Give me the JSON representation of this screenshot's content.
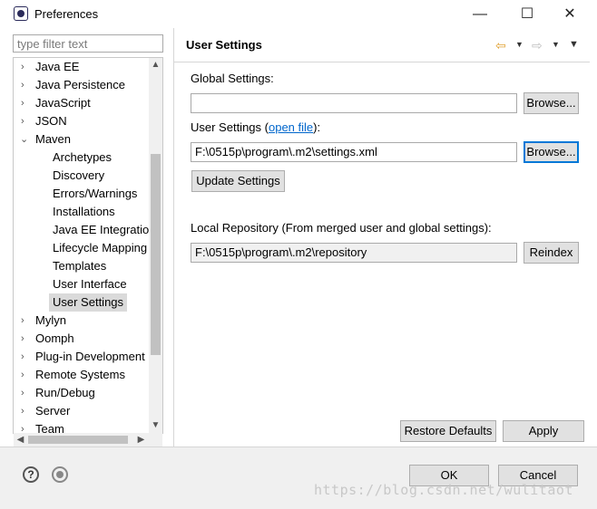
{
  "window": {
    "title": "Preferences",
    "minimize": "—",
    "maximize": "☐",
    "close": "✕"
  },
  "sidebar": {
    "filter_placeholder": "type filter text",
    "items": [
      {
        "label": "Java EE",
        "expander": "›"
      },
      {
        "label": "Java Persistence",
        "expander": "›"
      },
      {
        "label": "JavaScript",
        "expander": "›"
      },
      {
        "label": "JSON",
        "expander": "›"
      },
      {
        "label": "Maven",
        "expander": "⌄"
      },
      {
        "label": "Archetypes"
      },
      {
        "label": "Discovery"
      },
      {
        "label": "Errors/Warnings"
      },
      {
        "label": "Installations"
      },
      {
        "label": "Java EE Integration"
      },
      {
        "label": "Lifecycle Mapping"
      },
      {
        "label": "Templates"
      },
      {
        "label": "User Interface"
      },
      {
        "label": "User Settings"
      },
      {
        "label": "Mylyn",
        "expander": "›"
      },
      {
        "label": "Oomph",
        "expander": "›"
      },
      {
        "label": "Plug-in Development",
        "expander": "›"
      },
      {
        "label": "Remote Systems",
        "expander": "›"
      },
      {
        "label": "Run/Debug",
        "expander": "›"
      },
      {
        "label": "Server",
        "expander": "›"
      },
      {
        "label": "Team",
        "expander": "›"
      }
    ],
    "scroll_up": "▲",
    "scroll_down": "▼",
    "scroll_left": "◀",
    "scroll_right": "▶"
  },
  "main": {
    "title": "User Settings",
    "global_settings_label": "Global Settings:",
    "global_settings_value": "",
    "browse_label": "Browse...",
    "user_settings_label_prefix": "User Settings (",
    "user_settings_link": "open file",
    "user_settings_label_suffix": "):",
    "user_settings_value": "F:\\0515p\\program\\.m2\\settings.xml",
    "update_settings_label": "Update Settings",
    "local_repo_label": "Local Repository (From merged user and global settings):",
    "local_repo_value": "F:\\0515p\\program\\.m2\\repository",
    "reindex_label": "Reindex",
    "restore_defaults_label": "Restore Defaults",
    "apply_label": "Apply"
  },
  "footer": {
    "help_icon_glyph": "?",
    "ok_label": "OK",
    "cancel_label": "Cancel",
    "watermark": "https://blog.csdn.net/wulitaot"
  },
  "colors": {
    "accent": "#0078d7",
    "link": "#0066cc",
    "nav_arrow": "#e0a030"
  }
}
